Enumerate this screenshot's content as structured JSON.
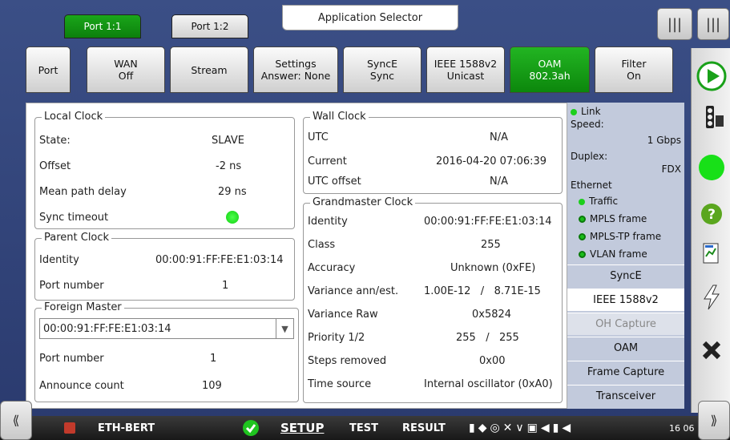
{
  "ports": [
    {
      "label": "Port 1:1",
      "active": true
    },
    {
      "label": "Port 1:2",
      "active": false
    }
  ],
  "app_selector": "Application Selector",
  "nav_tabs": [
    {
      "l1": "Port",
      "l2": ""
    },
    {
      "l1": "WAN",
      "l2": "Off"
    },
    {
      "l1": "Stream",
      "l2": ""
    },
    {
      "l1": "Settings",
      "l2": "Answer: None"
    },
    {
      "l1": "SyncE",
      "l2": "Sync"
    },
    {
      "l1": "IEEE 1588v2",
      "l2": "Unicast"
    },
    {
      "l1": "OAM",
      "l2": "802.3ah"
    },
    {
      "l1": "Filter",
      "l2": "On"
    }
  ],
  "local_clock": {
    "title": "Local Clock",
    "state_label": "State:",
    "state_value": "SLAVE",
    "offset_label": "Offset",
    "offset_value": "-2 ns",
    "mpd_label": "Mean path delay",
    "mpd_value": "29 ns",
    "sync_label": "Sync timeout"
  },
  "parent_clock": {
    "title": "Parent Clock",
    "identity_label": "Identity",
    "identity_value": "00:00:91:FF:FE:E1:03:14",
    "port_label": "Port number",
    "port_value": "1"
  },
  "foreign_master": {
    "title": "Foreign Master",
    "selected": "00:00:91:FF:FE:E1:03:14",
    "port_label": "Port number",
    "port_value": "1",
    "announce_label": "Announce count",
    "announce_value": "109"
  },
  "wall_clock": {
    "title": "Wall Clock",
    "utc_label": "UTC",
    "utc_value": "N/A",
    "current_label": "Current",
    "current_value": "2016-04-20 07:06:39",
    "utc_offset_label": "UTC offset",
    "utc_offset_value": "N/A"
  },
  "grandmaster": {
    "title": "Grandmaster Clock",
    "identity_label": "Identity",
    "identity_value": "00:00:91:FF:FE:E1:03:14",
    "class_label": "Class",
    "class_value": "255",
    "accuracy_label": "Accuracy",
    "accuracy_value": "Unknown (0xFE)",
    "variance_label": "Variance ann/est.",
    "variance_value": "1.00E-12   /   8.71E-15",
    "variance_raw_label": "Variance Raw",
    "variance_raw_value": "0x5824",
    "priority_label": "Priority 1/2",
    "priority_value": "255   /   255",
    "steps_label": "Steps removed",
    "steps_value": "0x00",
    "time_source_label": "Time source",
    "time_source_value": "Internal oscillator (0xA0)"
  },
  "status": {
    "link": "Link",
    "speed_label": "Speed:",
    "speed_value": "1 Gbps",
    "duplex_label": "Duplex:",
    "duplex_value": "FDX",
    "ethernet": "Ethernet",
    "traffic": "Traffic",
    "mpls": "MPLS frame",
    "mplstp": "MPLS-TP frame",
    "vlan": "VLAN frame"
  },
  "side_tabs": [
    "SyncE",
    "IEEE 1588v2",
    "OH Capture",
    "OAM",
    "Frame Capture",
    "Transceiver"
  ],
  "bottom": {
    "app": "ETH-BERT",
    "setup": "SETUP",
    "test": "TEST",
    "result": "RESULT",
    "time": "16 06"
  },
  "colors": {
    "accent_green": "#12a012",
    "panel_status": "#c2cadc"
  }
}
